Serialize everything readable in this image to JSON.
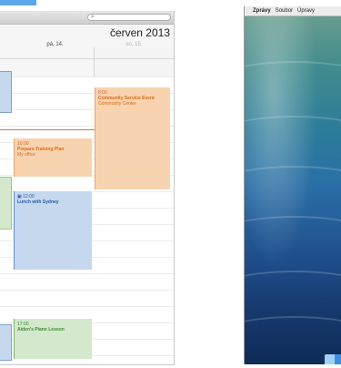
{
  "calendar": {
    "month_title": "červen 2013",
    "day_friday": "pá, 14.",
    "day_saturday": "so, 15.",
    "events": [
      {
        "time": "8:00",
        "title": "Community Service Event",
        "location": "Community Center",
        "color": "#f8d3b0"
      },
      {
        "time": "10:00",
        "title": "Prepare Training Plan",
        "location": "My office",
        "color": "#f8d3b0"
      },
      {
        "time": "12:00",
        "title": "Lunch with Sydney",
        "color": "#c5d8ee"
      },
      {
        "time": "17:00",
        "title": "Aiden's Piano Lesson",
        "color": "#d3e8cc"
      }
    ],
    "search_icon": "search-icon"
  },
  "desktop": {
    "menubar": {
      "apple_icon": "apple-icon",
      "app": "Zprávy",
      "items": [
        "Soubor",
        "Úpravy"
      ]
    },
    "dock_icon": "finder-icon"
  }
}
